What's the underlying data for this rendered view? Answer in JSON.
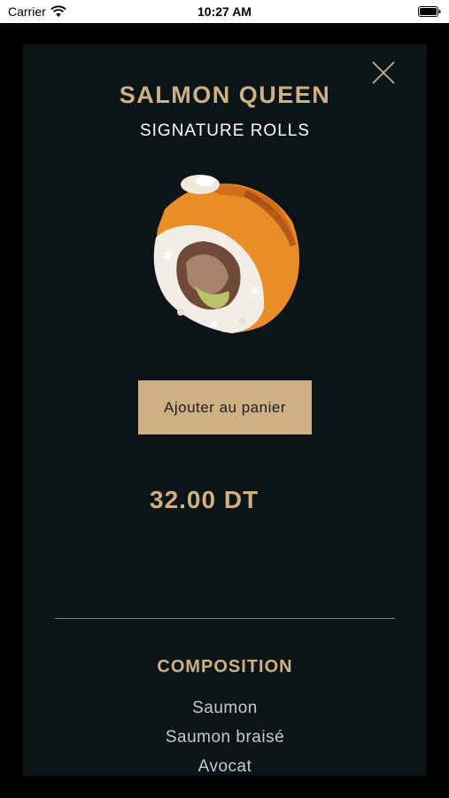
{
  "status_bar": {
    "carrier": "Carrier",
    "time": "10:27 AM",
    "icons": [
      "wifi-icon",
      "battery-icon"
    ]
  },
  "product": {
    "title": "SALMON QUEEN",
    "category": "SIGNATURE ROLLS",
    "image": "salmon-sushi-roll",
    "add_to_cart_label": "Ajouter au panier",
    "price": "32.00 DT"
  },
  "composition": {
    "heading": "COMPOSITION",
    "items": [
      "Saumon",
      "Saumon braisé",
      "Avocat"
    ]
  },
  "icons": {
    "close": "close-icon"
  },
  "colors": {
    "accent": "#cfb083",
    "modal_background": "#0b1416",
    "backdrop": "#000000",
    "title_text": "#ffffff",
    "list_text": "#c9c9c9"
  }
}
